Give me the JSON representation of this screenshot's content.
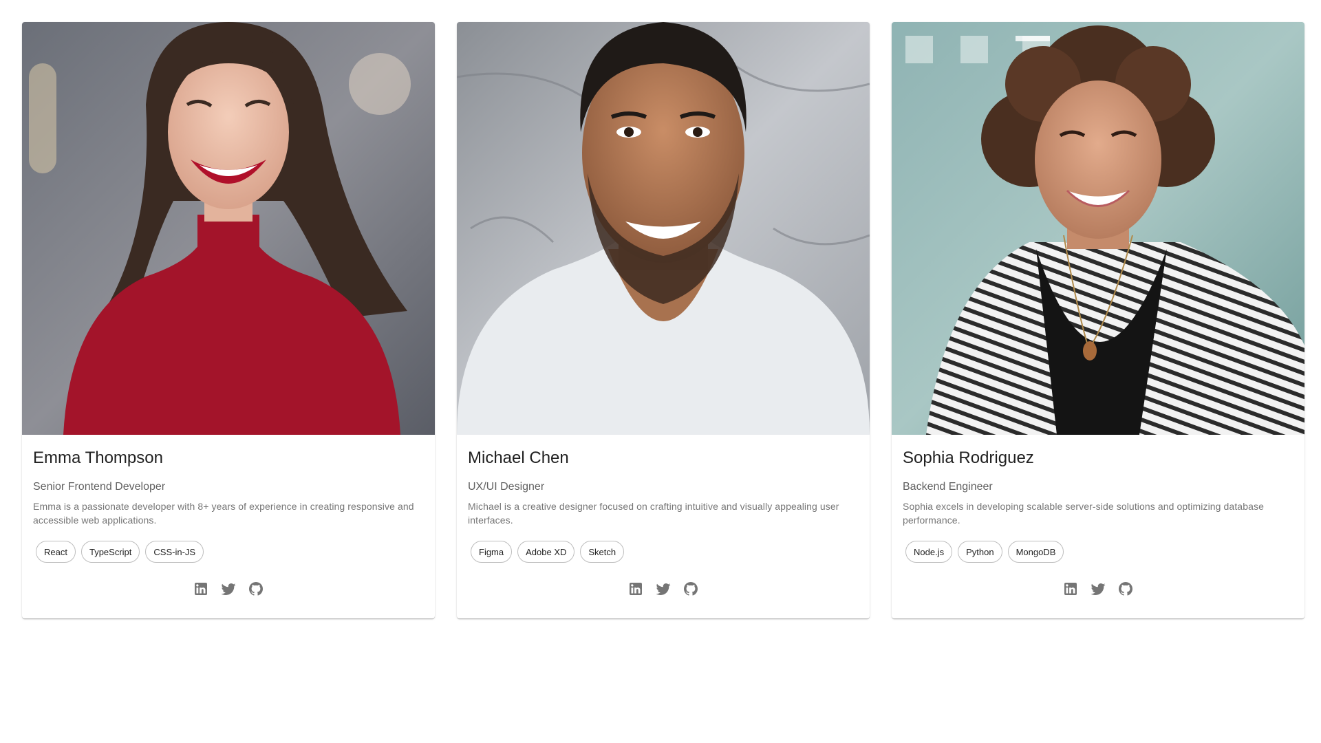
{
  "members": [
    {
      "name": "Emma Thompson",
      "role": "Senior Frontend Developer",
      "bio": "Emma is a passionate developer with 8+ years of experience in creating responsive and accessible web applications.",
      "skills": [
        "React",
        "TypeScript",
        "CSS-in-JS"
      ],
      "photo_icon": "portrait-photo-woman-red-sweater"
    },
    {
      "name": "Michael Chen",
      "role": "UX/UI Designer",
      "bio": "Michael is a creative designer focused on crafting intuitive and visually appealing user interfaces.",
      "skills": [
        "Figma",
        "Adobe XD",
        "Sketch"
      ],
      "photo_icon": "portrait-photo-man-white-tshirt"
    },
    {
      "name": "Sophia Rodriguez",
      "role": "Backend Engineer",
      "bio": "Sophia excels in developing scalable server-side solutions and optimizing database performance.",
      "skills": [
        "Node.js",
        "Python",
        "MongoDB"
      ],
      "photo_icon": "portrait-photo-woman-striped-cardigan"
    }
  ],
  "social_icons": [
    "linkedin-icon",
    "twitter-icon",
    "github-icon"
  ],
  "colors": {
    "icon": "#757575",
    "chip_border": "#bdbdbd",
    "title": "#212121",
    "subtitle": "#616161"
  }
}
